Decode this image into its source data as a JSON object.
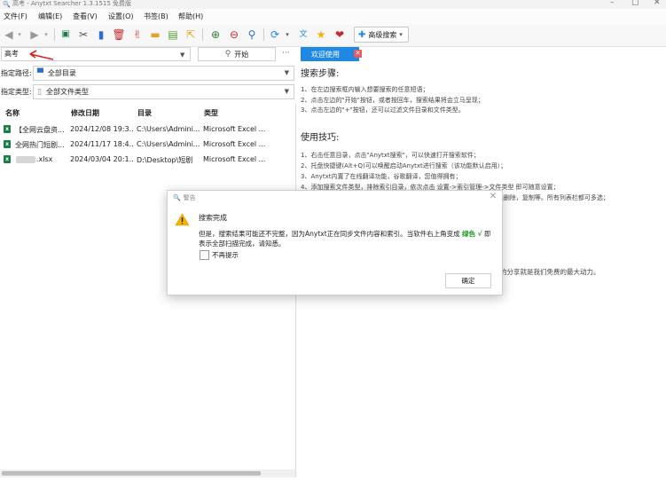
{
  "window": {
    "title": "高考 - Anytxt Searcher 1.3.1515 免费版",
    "controls": [
      "–",
      "▢",
      "✕"
    ]
  },
  "menu": [
    "文件(F)",
    "编辑(E)",
    "查看(V)",
    "设置(O)",
    "书签(B)",
    "帮助(H)"
  ],
  "toolbar": {
    "advanced_search_label": "高级搜索"
  },
  "search": {
    "query": "高考",
    "start_label": "开始",
    "more_label": "···"
  },
  "filters": {
    "path_label": "指定路径:",
    "path_value": "全部目录",
    "type_label": "指定类型:",
    "type_value": "全部文件类型"
  },
  "table": {
    "columns": [
      "名称",
      "修改日期",
      "目录",
      "类型"
    ],
    "rows": [
      {
        "name": "【全网云盘资...",
        "date": "2024/12/08 19:3...",
        "dir": "C:\\Users\\Admini...",
        "type": "Microsoft Excel ..."
      },
      {
        "name": "全网热门短剧...",
        "date": "2024/11/17 18:4...",
        "dir": "C:\\Users\\Admini...",
        "type": "Microsoft Excel ..."
      },
      {
        "name": ".xlsx",
        "date": "2024/03/04 20:1...",
        "dir": "D:\\Desktop\\短剧",
        "type": "Microsoft Excel ..."
      }
    ]
  },
  "welcome": {
    "tab_label": "欢迎使用",
    "steps_title": "搜索步骤:",
    "steps": [
      "1、在左边搜索框内输入想要搜索的任意短语；",
      "2、点击左边的\"开始\"按钮，或者按回车，搜索结果将会立马呈现；",
      "3、点击左边的\"+\"按钮，还可以过滤文件目录和文件类型。"
    ],
    "tips_title": "使用技巧:",
    "tips": [
      "1、右击任意目录，点击\"Anytxt搜索\"，可以快速打开搜索软件；",
      "2、托盘快捷键(Alt+Q)可以唤醒启动Anytxt进行搜索（该功能默认启用）；",
      "3、Anytxt内置了在线翻译功能，谷歌翻译，您值得拥有；",
      "4、添加搜索文件类型，排除索引目录，依次点击 设置->索引管理->文件类型 即可随意设置；",
      "5、多选搜索结果列表，按住Ctrl或Shift键，然后鼠标依次点击列即可多选删除，复制等。所有列表栏都可多选；"
    ],
    "partial_tail": "的分享就是我们免费的最大动力。"
  },
  "dialog": {
    "title": "警告",
    "heading": "搜索完成",
    "message_a": "但是，搜索结果可能还不完整，因为Anytxt正在同步文件内容和索引。当软件右上角变成",
    "message_green": "绿色 √",
    "message_b": "即表示全部扫描完成，请知悉。",
    "checkbox_label": "不再提示",
    "ok_label": "确定"
  }
}
